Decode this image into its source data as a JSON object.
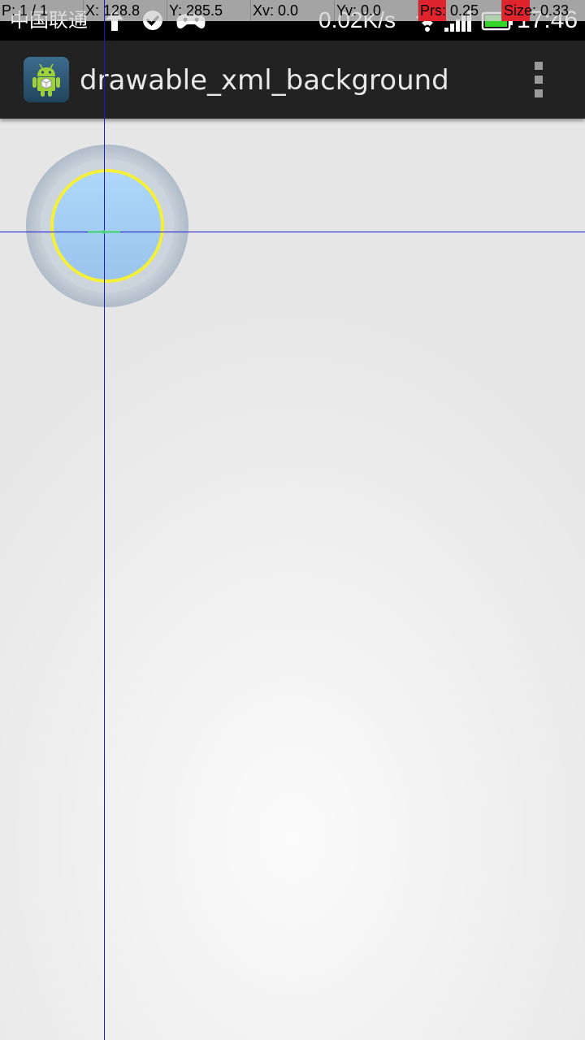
{
  "status_bar": {
    "carrier": "中国联通",
    "net_speed": "0.02K/s",
    "clock": "17:46",
    "icons": [
      "upload-arrow-icon",
      "check-circle-icon",
      "gamepad-icon",
      "wifi-icon",
      "signal-icon",
      "battery-icon"
    ]
  },
  "pointer_location": {
    "pointers": "P: 1 / 1",
    "x": "X: 128.8",
    "y": "Y: 285.5",
    "xv": "Xv: 0.0",
    "yv": "Yv: 0.0",
    "prs": "Prs: 0.25",
    "size": "Size: 0.33"
  },
  "action_bar": {
    "title": "drawable_xml_background",
    "icon": "android-app-icon",
    "menu_icon": "overflow-menu-icon"
  },
  "colors": {
    "action_bar_bg": "#222222",
    "ring_outer": "#b9c3cf",
    "ring_inner_fill": "#a6cff5",
    "ring_stroke": "#f4ef3a",
    "crosshair": "#1a1acc",
    "battery": "#35d42a"
  }
}
